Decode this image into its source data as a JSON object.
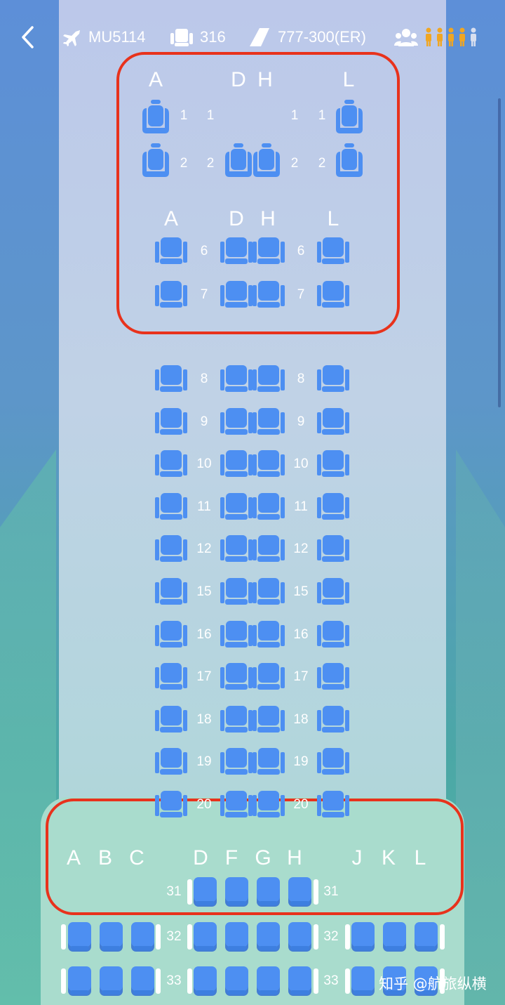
{
  "header": {
    "back_icon": "chevron-left-icon",
    "flight_number": "MU5114",
    "seat_count": "316",
    "aircraft_type": "777-300(ER)",
    "passenger_icon": "passenger-group-icon",
    "load_icon": "load-level-icon"
  },
  "colors": {
    "seat": "#4d8ff2",
    "highlight": "#e8321c",
    "load_person": "#f0a623"
  },
  "first_class": {
    "columns": [
      "A",
      "D",
      "H",
      "L"
    ],
    "rows": [
      {
        "number_left": "1",
        "number_center_left": "1",
        "number_center_right": "1",
        "number_right": "1"
      },
      {
        "number_left": "2",
        "number_center_left": "2",
        "number_center_right": "2",
        "number_right": "2"
      }
    ]
  },
  "business_class": {
    "columns": [
      "A",
      "D",
      "H",
      "L"
    ],
    "rows": [
      "6",
      "7"
    ]
  },
  "premium_rows": [
    "8",
    "9",
    "10",
    "11",
    "12",
    "15",
    "16",
    "17",
    "18",
    "19",
    "20"
  ],
  "economy": {
    "columns": [
      "A",
      "B",
      "C",
      "D",
      "F",
      "G",
      "H",
      "J",
      "K",
      "L"
    ],
    "first_row": "31",
    "rows": [
      "32",
      "33"
    ]
  },
  "watermark": "知乎 @航旅纵横"
}
